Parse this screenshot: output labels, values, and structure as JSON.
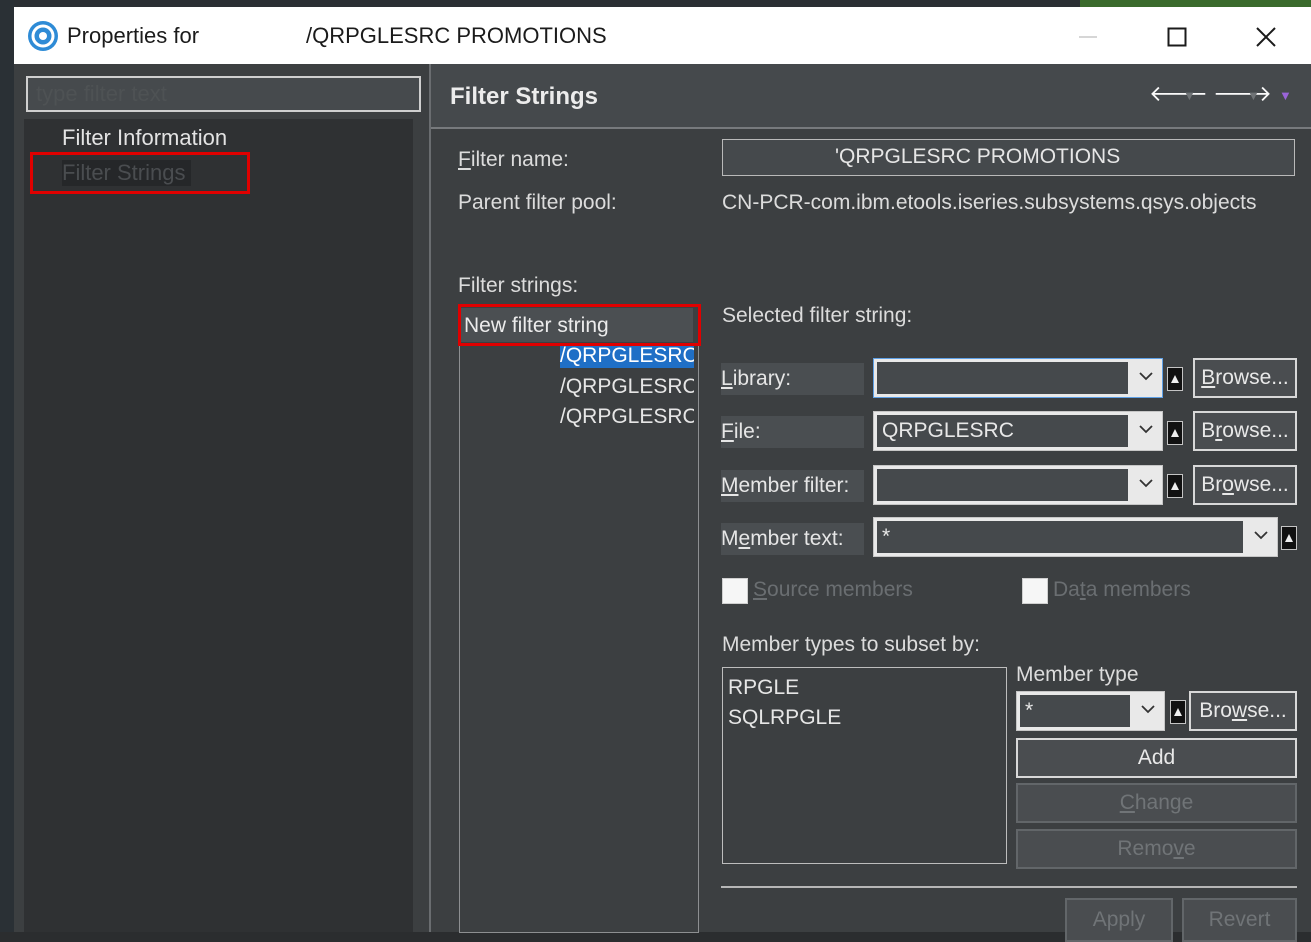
{
  "window": {
    "title_prefix": "Properties for",
    "title_path": "/QRPGLESRC PROMOTIONS",
    "icon": "app-logo-icon",
    "controls": [
      "minimize-icon",
      "maximize-icon",
      "close-icon"
    ]
  },
  "sidebar": {
    "filter_placeholder": "type filter text",
    "items": [
      {
        "label": "Filter Information"
      },
      {
        "label": "Filter Strings"
      }
    ]
  },
  "header": {
    "title": "Filter Strings",
    "nav_icons": [
      "back-arrow-icon",
      "forward-arrow-icon",
      "menu-dropdown-icon"
    ]
  },
  "form": {
    "filter_name_label": "Filter name:",
    "filter_name_value": "'QRPGLESRC PROMOTIONS",
    "parent_pool_label": "Parent filter pool:",
    "parent_pool_value": "CN-PCR-com.ibm.etools.iseries.subsystems.qsys.objects",
    "filter_strings_label": "Filter strings:"
  },
  "filter_strings_list": {
    "new_item": "New filter string",
    "items": [
      {
        "label": "/QRPGLESRC(",
        "selected": true
      },
      {
        "label": "/QRPGLESRC(",
        "selected": false
      },
      {
        "label": "/QRPGLESRC(",
        "selected": false
      }
    ]
  },
  "selected": {
    "heading": "Selected filter string:",
    "library_label": "Library:",
    "library_value": "",
    "file_label": "File:",
    "file_value": "QRPGLESRC",
    "member_filter_label": "Member filter:",
    "member_filter_value": "",
    "member_text_label": "Member text:",
    "member_text_value": "*",
    "browse_label": "Browse...",
    "source_members": "Source members",
    "data_members": "Data members"
  },
  "member_types": {
    "heading": "Member types to subset by:",
    "items": [
      "RPGLE",
      "SQLRPGLE"
    ],
    "type_label": "Member type",
    "type_value": "*",
    "browse_label": "Browse...",
    "add": "Add",
    "change": "Change",
    "remove": "Remove"
  },
  "footer": {
    "apply": "Apply",
    "revert": "Revert"
  }
}
